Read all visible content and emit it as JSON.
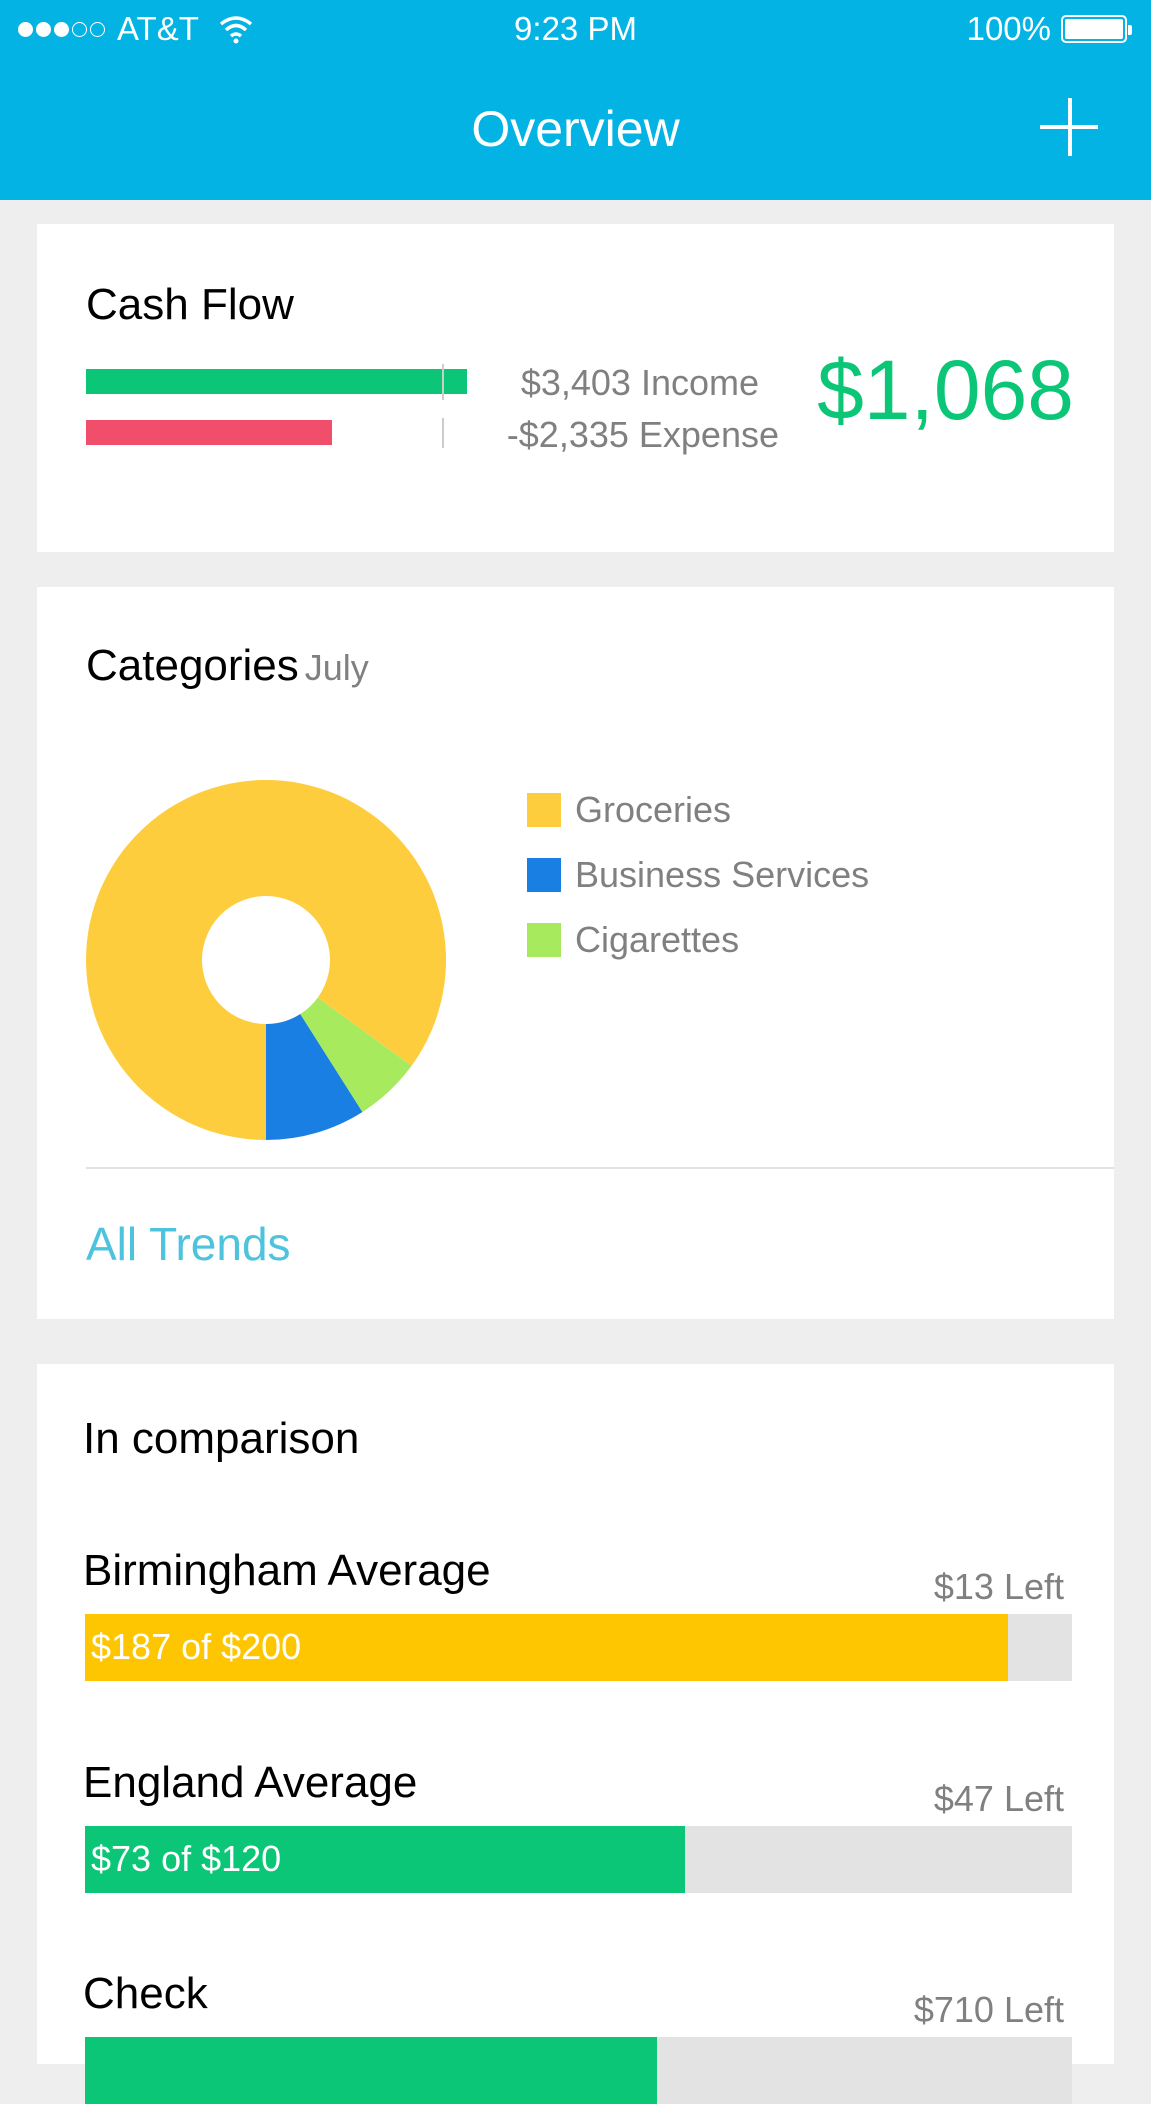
{
  "status_bar": {
    "signal_dots_filled": 3,
    "signal_dots_total": 5,
    "carrier": "AT&T",
    "time": "9:23 PM",
    "battery": "100%",
    "battery_level": 1.0
  },
  "navbar": {
    "title": "Overview",
    "add_icon": "plus-icon"
  },
  "cash_flow": {
    "title": "Cash Flow",
    "income": "$3,403 Income",
    "expense": "-$2,335 Expense",
    "net": "$1,068",
    "income_value": 3403,
    "expense_value": 2335,
    "colors": {
      "income": "#0cc677",
      "expense": "#f04e6b",
      "net": "#0cc677"
    }
  },
  "categories": {
    "title": "Categories",
    "period": "July",
    "all_trends_label": "All Trends",
    "chart_data": {
      "type": "pie",
      "donut": true,
      "title": "Categories July",
      "categories": [
        "Groceries",
        "Business Services",
        "Cigarettes"
      ],
      "values": [
        85,
        9,
        6
      ],
      "colors": [
        "#fecd3e",
        "#1a7fe3",
        "#a7ea5e"
      ],
      "legend": "right"
    }
  },
  "comparison": {
    "title": "In comparison",
    "rows": [
      {
        "name": "Birmingham Average",
        "left": "$13 Left",
        "label": "$187 of $200",
        "spent": 187,
        "total": 200,
        "color": "#fec600"
      },
      {
        "name": "England Average",
        "left": "$47 Left",
        "label": "$73 of $120",
        "spent": 73,
        "total": 120,
        "color": "#0cc677"
      },
      {
        "name": "Check",
        "left": "$710 Left",
        "label": "",
        "spent": 0.58,
        "total": 1,
        "color": "#0cc677"
      }
    ]
  }
}
